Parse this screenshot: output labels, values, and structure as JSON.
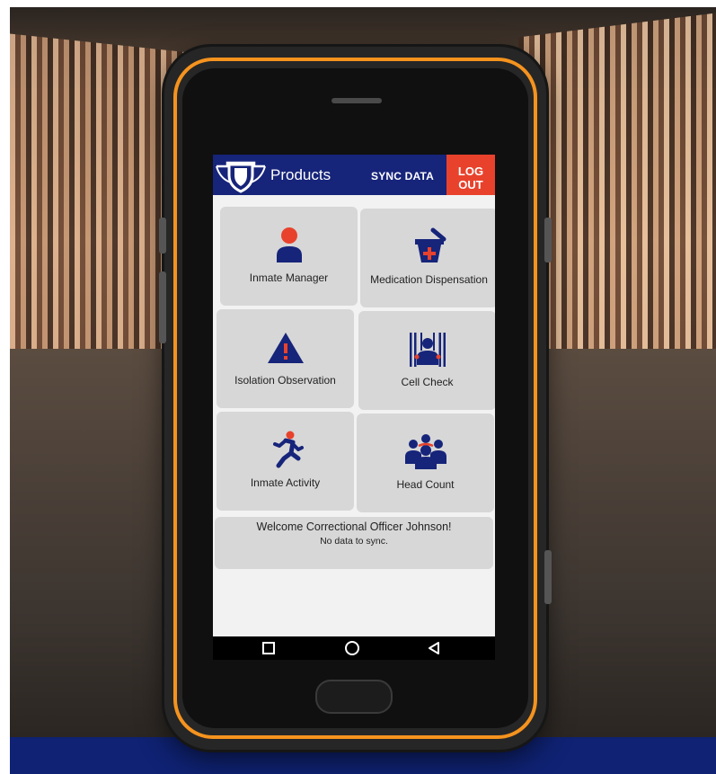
{
  "app": {
    "title": "Products",
    "sync_label": "SYNC DATA",
    "logout_line1": "LOG",
    "logout_line2": "OUT"
  },
  "tiles": [
    {
      "label": "Inmate Manager",
      "icon": "inmate-manager-icon"
    },
    {
      "label": "Medication Dispensation",
      "icon": "medication-icon"
    },
    {
      "label": "Isolation Observation",
      "icon": "warning-icon"
    },
    {
      "label": "Cell Check",
      "icon": "cell-check-icon"
    },
    {
      "label": "Inmate Activity",
      "icon": "runner-icon"
    },
    {
      "label": "Head Count",
      "icon": "head-count-icon"
    }
  ],
  "welcome": {
    "message": "Welcome Correctional Officer Johnson!",
    "sync_status": "No data to sync."
  },
  "navbar": [
    "square-icon",
    "circle-icon",
    "back-triangle-icon"
  ],
  "colors": {
    "header": "#16247a",
    "logout": "#e8422c",
    "tile": "#d7d7d7",
    "icon_navy": "#16247a",
    "icon_accent": "#e8422c",
    "phone_trim": "#f5931e",
    "footer_band": "#0f2273"
  }
}
